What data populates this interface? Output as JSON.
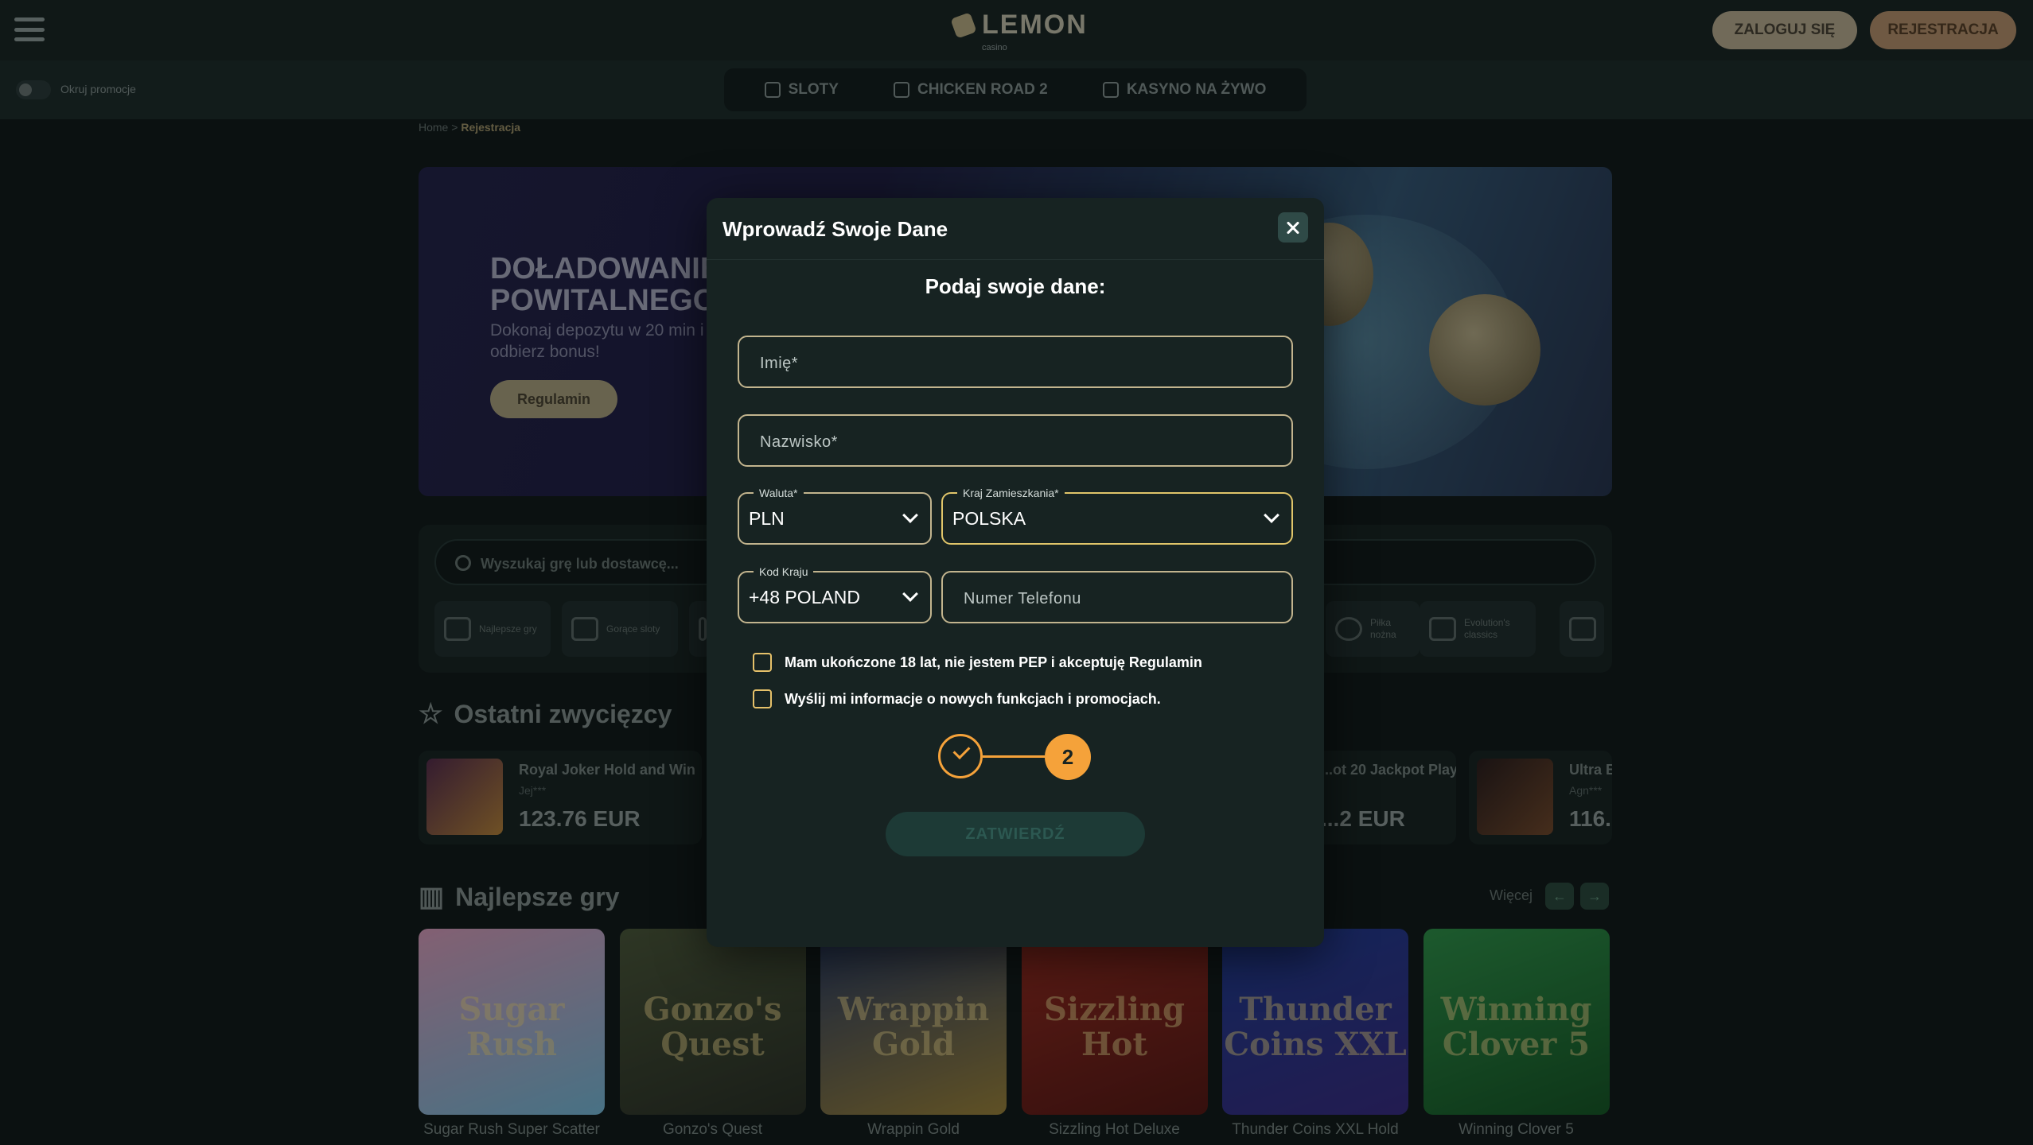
{
  "header": {
    "logo_text": "LEMON",
    "logo_sub": "casino",
    "login_label": "ZALOGUJ SIĘ",
    "register_label": "REJESTRACJA"
  },
  "subbar": {
    "toggle_label": "Okruj promocje",
    "categories": [
      {
        "label": "SLOTY",
        "icon": "slot-icon"
      },
      {
        "label": "CHICKEN ROAD 2",
        "icon": "chicken-icon"
      },
      {
        "label": "KASYNO NA ŻYWO",
        "icon": "live-casino-icon"
      }
    ]
  },
  "breadcrumb": {
    "home": "Home",
    "separator": ">",
    "current": "Rejestracja"
  },
  "banner": {
    "title": "DOŁADOWANIE POWITALNEGO",
    "text": "Dokonaj depozytu w 20 min i odbierz bonus!",
    "button": "Regulamin"
  },
  "search": {
    "placeholder": "Wyszukaj grę lub dostawcę...",
    "chips": [
      {
        "label": "Najlepsze gry",
        "icon": "top-games-icon"
      },
      {
        "label": "Gorące sloty",
        "icon": "hot-icon"
      },
      {
        "label": "",
        "icon": "category-icon"
      },
      {
        "label": "Piłka nożna",
        "icon": "football-icon"
      },
      {
        "label": "Evolution's classics",
        "icon": "trophy-icon"
      },
      {
        "label": "",
        "icon": "category-icon"
      }
    ]
  },
  "winners": {
    "title": "Ostatni zwycięzcy",
    "items": [
      {
        "game": "Royal Joker Hold and Win",
        "user": "Jej***",
        "amount": "123.76 EUR"
      },
      {
        "game": "...ot 20 Jackpot Play",
        "user": "",
        "amount": "...2 EUR"
      },
      {
        "game": "Ultra B...",
        "user": "Agn***",
        "amount": "116..."
      }
    ]
  },
  "top_games": {
    "title": "Najlepsze gry",
    "more": "Więcej",
    "prev": "←",
    "next": "→",
    "items": [
      {
        "name": "Sugar Rush Super Scatter",
        "art": "Sugar Rush",
        "color1": "#e9a6c8",
        "color2": "#7ec6e8"
      },
      {
        "name": "Gonzo's Quest",
        "art": "Gonzo's Quest",
        "color1": "#4f5a3a",
        "color2": "#2b2f24"
      },
      {
        "name": "Wrappin Gold",
        "art": "Wrappin Gold",
        "color1": "#2a3c6a",
        "color2": "#a88a3a"
      },
      {
        "name": "Sizzling Hot Deluxe",
        "art": "Sizzling Hot",
        "color1": "#a32a1e",
        "color2": "#5c1410"
      },
      {
        "name": "Thunder Coins XXL Hold",
        "art": "Thunder Coins XXL",
        "color1": "#1f3c9a",
        "color2": "#3a2a8a"
      },
      {
        "name": "Winning Clover 5",
        "art": "Winning Clover 5",
        "color1": "#2f9a4a",
        "color2": "#145a24"
      }
    ]
  },
  "modal": {
    "title": "Wprowadź Swoje Dane",
    "subtitle": "Podaj swoje dane:",
    "first_name_placeholder": "Imię*",
    "last_name_placeholder": "Nazwisko*",
    "currency": {
      "label": "Waluta*",
      "value": "PLN"
    },
    "country": {
      "label": "Kraj Zamieszkania*",
      "value": "POLSKA"
    },
    "country_code": {
      "label": "Kod Kraju",
      "value": "+48 POLAND"
    },
    "phone_placeholder": "Numer Telefonu",
    "consent_terms": "Mam ukończone 18 lat, nie jestem PEP i akceptuję Regulamin",
    "consent_marketing": "Wyślij mi informacje o nowych funkcjach i promocjach.",
    "step_current": "2",
    "submit_label": "ZATWIERDŹ",
    "accent_color": "#f5a23a",
    "field_border_color": "#c2b48e"
  }
}
